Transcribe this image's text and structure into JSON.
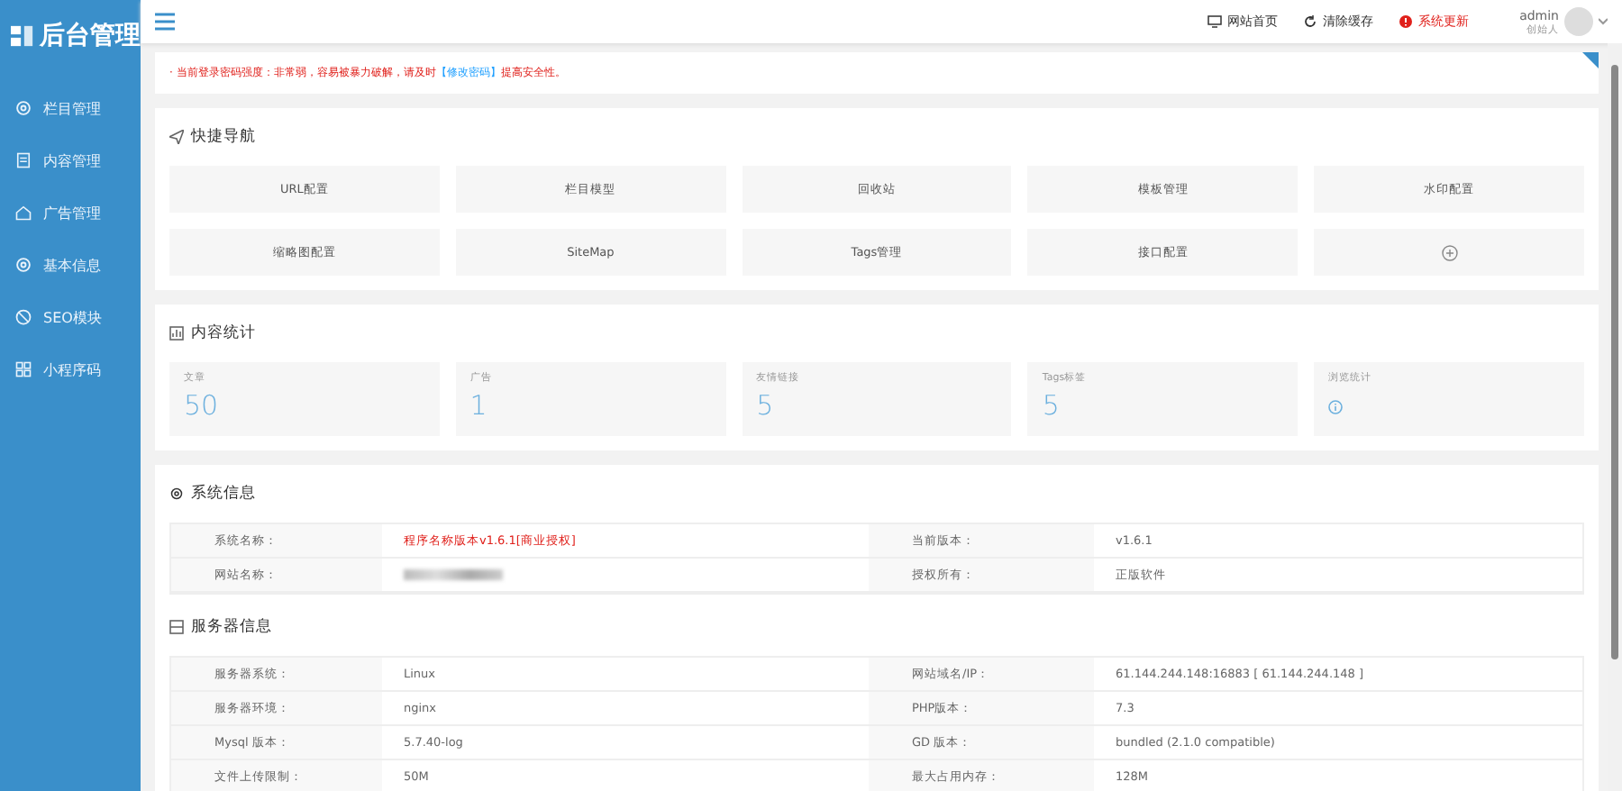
{
  "sidebar": {
    "logo": "后台管理",
    "items": [
      {
        "label": "栏目管理"
      },
      {
        "label": "内容管理"
      },
      {
        "label": "广告管理"
      },
      {
        "label": "基本信息"
      },
      {
        "label": "SEO模块"
      },
      {
        "label": "小程序码"
      }
    ]
  },
  "header": {
    "links": [
      {
        "label": "网站首页",
        "kind": "normal"
      },
      {
        "label": "清除缓存",
        "kind": "normal"
      },
      {
        "label": "系统更新",
        "kind": "danger"
      }
    ],
    "user": {
      "name": "admin",
      "role": "创始人"
    }
  },
  "alert": {
    "text": "· 当前登录密码强度：非常弱，容易被暴力破解，请及时",
    "link": "【修改密码】",
    "after": "提高安全性。"
  },
  "quick_nav": {
    "title": "快捷导航",
    "items": [
      {
        "label": "URL配置",
        "kind": "text"
      },
      {
        "label": "栏目模型",
        "kind": "text"
      },
      {
        "label": "回收站",
        "kind": "text"
      },
      {
        "label": "模板管理",
        "kind": "text"
      },
      {
        "label": "水印配置",
        "kind": "text"
      },
      {
        "label": "缩略图配置",
        "kind": "text"
      },
      {
        "label": "SiteMap",
        "kind": "text"
      },
      {
        "label": "Tags管理",
        "kind": "text"
      },
      {
        "label": "接口配置",
        "kind": "text"
      },
      {
        "kind": "add"
      }
    ]
  },
  "stats": {
    "title": "内容统计",
    "items": [
      {
        "label": "文章",
        "value": "50",
        "kind": "number"
      },
      {
        "label": "广告",
        "value": "1",
        "kind": "number"
      },
      {
        "label": "友情链接",
        "value": "5",
        "kind": "number"
      },
      {
        "label": "Tags标签",
        "value": "5",
        "kind": "number"
      },
      {
        "label": "浏览统计",
        "kind": "info"
      }
    ]
  },
  "system_info": {
    "title": "系统信息",
    "rows": [
      [
        {
          "label": "系统名称：",
          "value": "程序名称版本v1.6.1[商业授权]",
          "kind": "highlight"
        },
        {
          "label": "当前版本：",
          "value": "v1.6.1",
          "kind": "plain"
        }
      ],
      [
        {
          "label": "网站名称：",
          "kind": "blurred"
        },
        {
          "label": "授权所有：",
          "value": "正版软件",
          "kind": "plain"
        }
      ]
    ]
  },
  "server_info": {
    "title": "服务器信息",
    "rows": [
      [
        {
          "label": "服务器系统：",
          "value": "Linux",
          "kind": "plain"
        },
        {
          "label": "网站域名/IP：",
          "value": "61.144.244.148:16883 [ 61.144.244.148 ]",
          "kind": "plain"
        }
      ],
      [
        {
          "label": "服务器环境：",
          "value": "nginx",
          "kind": "plain"
        },
        {
          "label": "PHP版本：",
          "value": "7.3",
          "kind": "plain"
        }
      ],
      [
        {
          "label": "Mysql 版本：",
          "value": "5.7.40-log",
          "kind": "plain"
        },
        {
          "label": "GD 版本：",
          "value": "bundled (2.1.0 compatible)",
          "kind": "plain"
        }
      ],
      [
        {
          "label": "文件上传限制：",
          "value": "50M",
          "kind": "plain"
        },
        {
          "label": "最大占用内存：",
          "value": "128M",
          "kind": "plain"
        }
      ]
    ]
  }
}
